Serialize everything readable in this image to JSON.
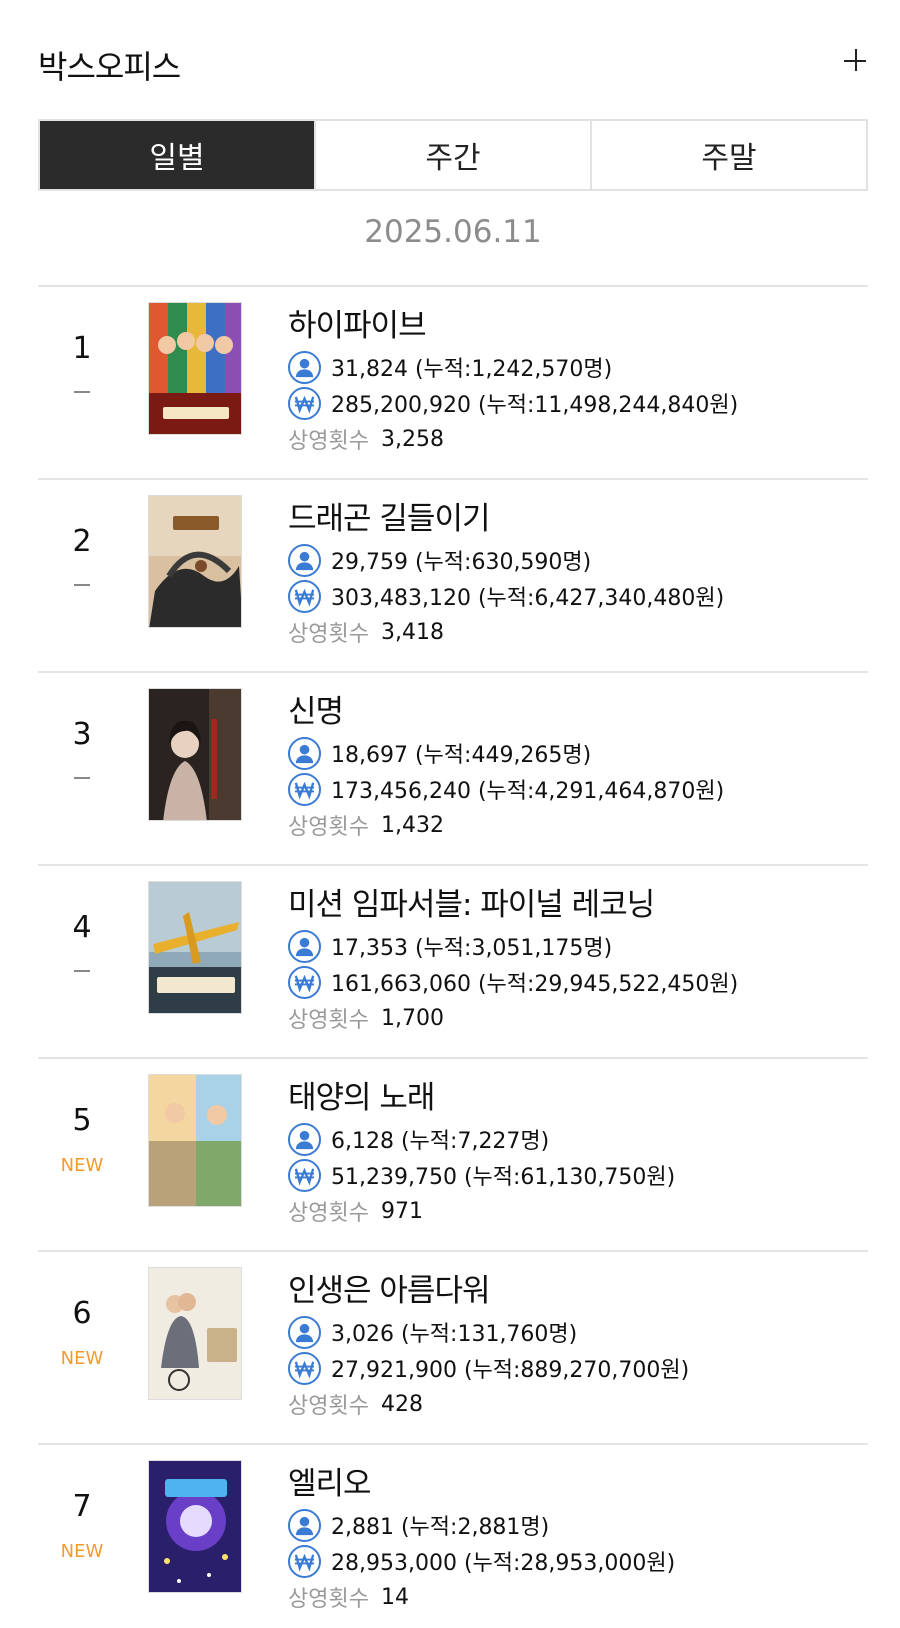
{
  "header": {
    "title": "박스오피스"
  },
  "tabs": [
    {
      "label": "일별",
      "active": true
    },
    {
      "label": "주간",
      "active": false
    },
    {
      "label": "주말",
      "active": false
    }
  ],
  "date": "2025.06.11",
  "screen_label": "상영횟수",
  "new_label": "NEW",
  "icons": {
    "audience": "person-icon",
    "sales": "won-icon"
  },
  "colors": {
    "accent_icon": "#3a7bd5",
    "new_badge": "#f39a2e",
    "active_tab": "#2b2b2b"
  },
  "movies": [
    {
      "rank": "1",
      "status": "same",
      "title": "하이파이브",
      "audience": "31,824 (누적:1,242,570명)",
      "sales": "285,200,920 (누적:11,498,244,840원)",
      "screenings": "3,258"
    },
    {
      "rank": "2",
      "status": "same",
      "title": "드래곤 길들이기",
      "audience": "29,759 (누적:630,590명)",
      "sales": "303,483,120 (누적:6,427,340,480원)",
      "screenings": "3,418"
    },
    {
      "rank": "3",
      "status": "same",
      "title": "신명",
      "audience": "18,697 (누적:449,265명)",
      "sales": "173,456,240 (누적:4,291,464,870원)",
      "screenings": "1,432"
    },
    {
      "rank": "4",
      "status": "same",
      "title": "미션 임파서블: 파이널 레코닝",
      "audience": "17,353 (누적:3,051,175명)",
      "sales": "161,663,060 (누적:29,945,522,450원)",
      "screenings": "1,700"
    },
    {
      "rank": "5",
      "status": "new",
      "title": "태양의 노래",
      "audience": "6,128 (누적:7,227명)",
      "sales": "51,239,750 (누적:61,130,750원)",
      "screenings": "971"
    },
    {
      "rank": "6",
      "status": "new",
      "title": "인생은 아름다워",
      "audience": "3,026 (누적:131,760명)",
      "sales": "27,921,900 (누적:889,270,700원)",
      "screenings": "428"
    },
    {
      "rank": "7",
      "status": "new",
      "title": "엘리오",
      "audience": "2,881 (누적:2,881명)",
      "sales": "28,953,000 (누적:28,953,000원)",
      "screenings": "14"
    }
  ]
}
